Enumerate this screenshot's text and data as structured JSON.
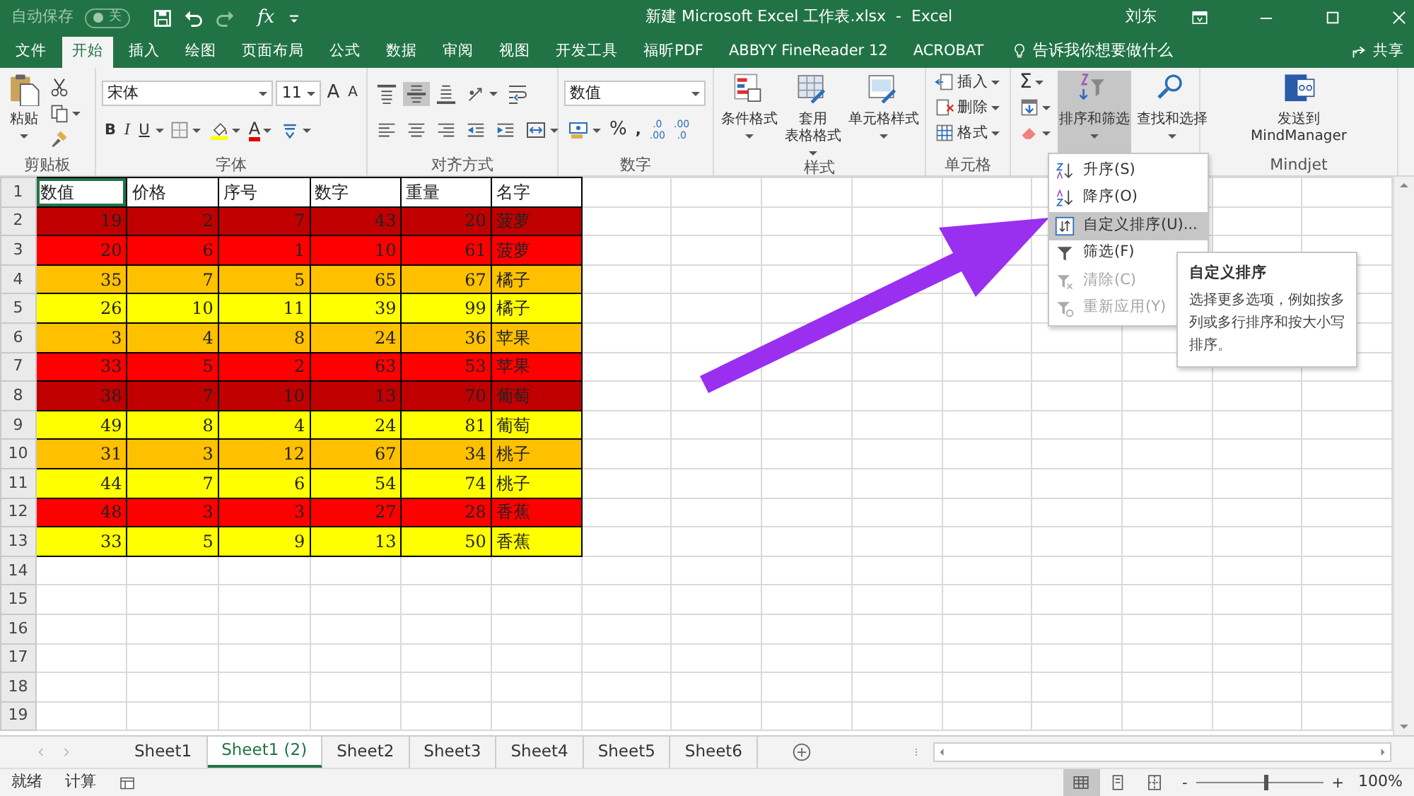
{
  "title_bar": {
    "autosave_label": "自动保存",
    "autosave": {
      "on": false,
      "label": "关"
    },
    "fx": "fx",
    "title": "新建 Microsoft Excel 工作表.xlsx  -  Excel",
    "user": "刘东"
  },
  "tabs": [
    {
      "label": "文件",
      "selected": false
    },
    {
      "label": "开始",
      "selected": true
    },
    {
      "label": "插入",
      "selected": false
    },
    {
      "label": "绘图",
      "selected": false
    },
    {
      "label": "页面布局",
      "selected": false
    },
    {
      "label": "公式",
      "selected": false
    },
    {
      "label": "数据",
      "selected": false
    },
    {
      "label": "审阅",
      "selected": false
    },
    {
      "label": "视图",
      "selected": false
    },
    {
      "label": "开发工具",
      "selected": false
    },
    {
      "label": "福昕PDF",
      "selected": false
    },
    {
      "label": "ABBYY FineReader 12",
      "selected": false
    },
    {
      "label": "ACROBAT",
      "selected": false
    }
  ],
  "tell_me": "告诉我你想要做什么",
  "share": "共享",
  "ribbon": [
    {
      "kind": "clipboard",
      "label": "剪贴板",
      "paste": "粘贴"
    },
    {
      "kind": "font",
      "label": "字体",
      "font_name": "宋体",
      "font_size": "11",
      "grow": "A",
      "shrink": "A",
      "bold": "B",
      "italic": "I",
      "underline": "U",
      "font_color": "A"
    },
    {
      "kind": "alignment",
      "label": "对齐方式",
      "vertical": [
        {
          "selected": false
        },
        {
          "selected": true
        },
        {
          "selected": false
        }
      ]
    },
    {
      "kind": "number",
      "label": "数字",
      "format": "数值",
      "percent": "%",
      "comma": ",",
      "increase_decimal": [
        ".0",
        ".00"
      ],
      "decrease_decimal": [
        ".00",
        ".0"
      ]
    },
    {
      "kind": "styles",
      "label": "样式",
      "buttons": [
        {
          "lines": [
            "条件格式"
          ]
        },
        {
          "lines": [
            "套用",
            "表格格式"
          ]
        },
        {
          "lines": [
            "单元格样式"
          ]
        }
      ]
    },
    {
      "kind": "cells",
      "label": "单元格",
      "buttons": [
        "插入",
        "删除",
        "格式"
      ]
    },
    {
      "kind": "editing",
      "sum": "Σ",
      "buttons": [
        {
          "lines": [
            "排序和筛选"
          ],
          "pressed": true
        },
        {
          "lines": [
            "查找和选择"
          ],
          "pressed": false
        }
      ]
    },
    {
      "kind": "mindjet",
      "label": "Mindjet",
      "buttons": [
        {
          "lines": [
            "发送到",
            "MindManager"
          ]
        }
      ]
    }
  ],
  "sheet": {
    "header": {
      "row": "1",
      "cells": [
        {
          "text": "数值",
          "selected": true
        },
        {
          "text": "价格",
          "selected": false
        },
        {
          "text": "序号",
          "selected": false
        },
        {
          "text": "数字",
          "selected": false
        },
        {
          "text": "重量",
          "selected": false
        },
        {
          "text": "名字",
          "selected": false
        }
      ]
    },
    "rows": [
      {
        "row": "2",
        "color": "#c00000",
        "cells": [
          "19",
          "2",
          "7",
          "43",
          "20",
          "菠萝"
        ]
      },
      {
        "row": "3",
        "color": "#ff0000",
        "cells": [
          "20",
          "6",
          "1",
          "10",
          "61",
          "菠萝"
        ]
      },
      {
        "row": "4",
        "color": "#ffc000",
        "cells": [
          "35",
          "7",
          "5",
          "65",
          "67",
          "橘子"
        ]
      },
      {
        "row": "5",
        "color": "#ffff00",
        "cells": [
          "26",
          "10",
          "11",
          "39",
          "99",
          "橘子"
        ]
      },
      {
        "row": "6",
        "color": "#ffc000",
        "cells": [
          "3",
          "4",
          "8",
          "24",
          "36",
          "苹果"
        ]
      },
      {
        "row": "7",
        "color": "#ff0000",
        "cells": [
          "33",
          "5",
          "2",
          "63",
          "53",
          "苹果"
        ]
      },
      {
        "row": "8",
        "color": "#c00000",
        "cells": [
          "38",
          "7",
          "10",
          "13",
          "70",
          "葡萄"
        ]
      },
      {
        "row": "9",
        "color": "#ffff00",
        "cells": [
          "49",
          "8",
          "4",
          "24",
          "81",
          "葡萄"
        ]
      },
      {
        "row": "10",
        "color": "#ffc000",
        "cells": [
          "31",
          "3",
          "12",
          "67",
          "34",
          "桃子"
        ]
      },
      {
        "row": "11",
        "color": "#ffff00",
        "cells": [
          "44",
          "7",
          "6",
          "54",
          "74",
          "桃子"
        ]
      },
      {
        "row": "12",
        "color": "#ff0000",
        "cells": [
          "48",
          "3",
          "3",
          "27",
          "28",
          "香蕉"
        ]
      },
      {
        "row": "13",
        "color": "#ffff00",
        "cells": [
          "33",
          "5",
          "9",
          "13",
          "50",
          "香蕉"
        ]
      }
    ],
    "empty_rows": [
      "14",
      "15",
      "16",
      "17",
      "18",
      "19"
    ]
  },
  "sort_menu": [
    {
      "kind": "asc",
      "label": "升序(S)",
      "selected": false,
      "disabled": false
    },
    {
      "kind": "desc",
      "label": "降序(O)",
      "selected": false,
      "disabled": false
    },
    {
      "kind": "custom",
      "label": "自定义排序(U)...",
      "selected": true,
      "disabled": false
    },
    {
      "kind": "filter",
      "label": "筛选(F)",
      "selected": false,
      "disabled": false
    },
    {
      "kind": "clear",
      "label": "清除(C)",
      "selected": false,
      "disabled": true
    },
    {
      "kind": "reapply",
      "label": "重新应用(Y)",
      "selected": false,
      "disabled": true
    }
  ],
  "tooltip": {
    "title": "自定义排序",
    "text": "选择更多选项，例如按多列或多行排序和按大小写排序。"
  },
  "sheet_tabs": [
    {
      "label": "Sheet1",
      "selected": false
    },
    {
      "label": "Sheet1 (2)",
      "selected": true
    },
    {
      "label": "Sheet2",
      "selected": false
    },
    {
      "label": "Sheet3",
      "selected": false
    },
    {
      "label": "Sheet4",
      "selected": false
    },
    {
      "label": "Sheet5",
      "selected": false
    },
    {
      "label": "Sheet6",
      "selected": false
    }
  ],
  "status_bar": {
    "ready": "就绪",
    "calc": "计算",
    "views": [
      {
        "selected": true
      },
      {
        "selected": false
      },
      {
        "selected": false
      }
    ],
    "zoom_out": "-",
    "zoom_in": "+",
    "zoom": {
      "level": 0.55
    },
    "zoom_label": "100%"
  }
}
